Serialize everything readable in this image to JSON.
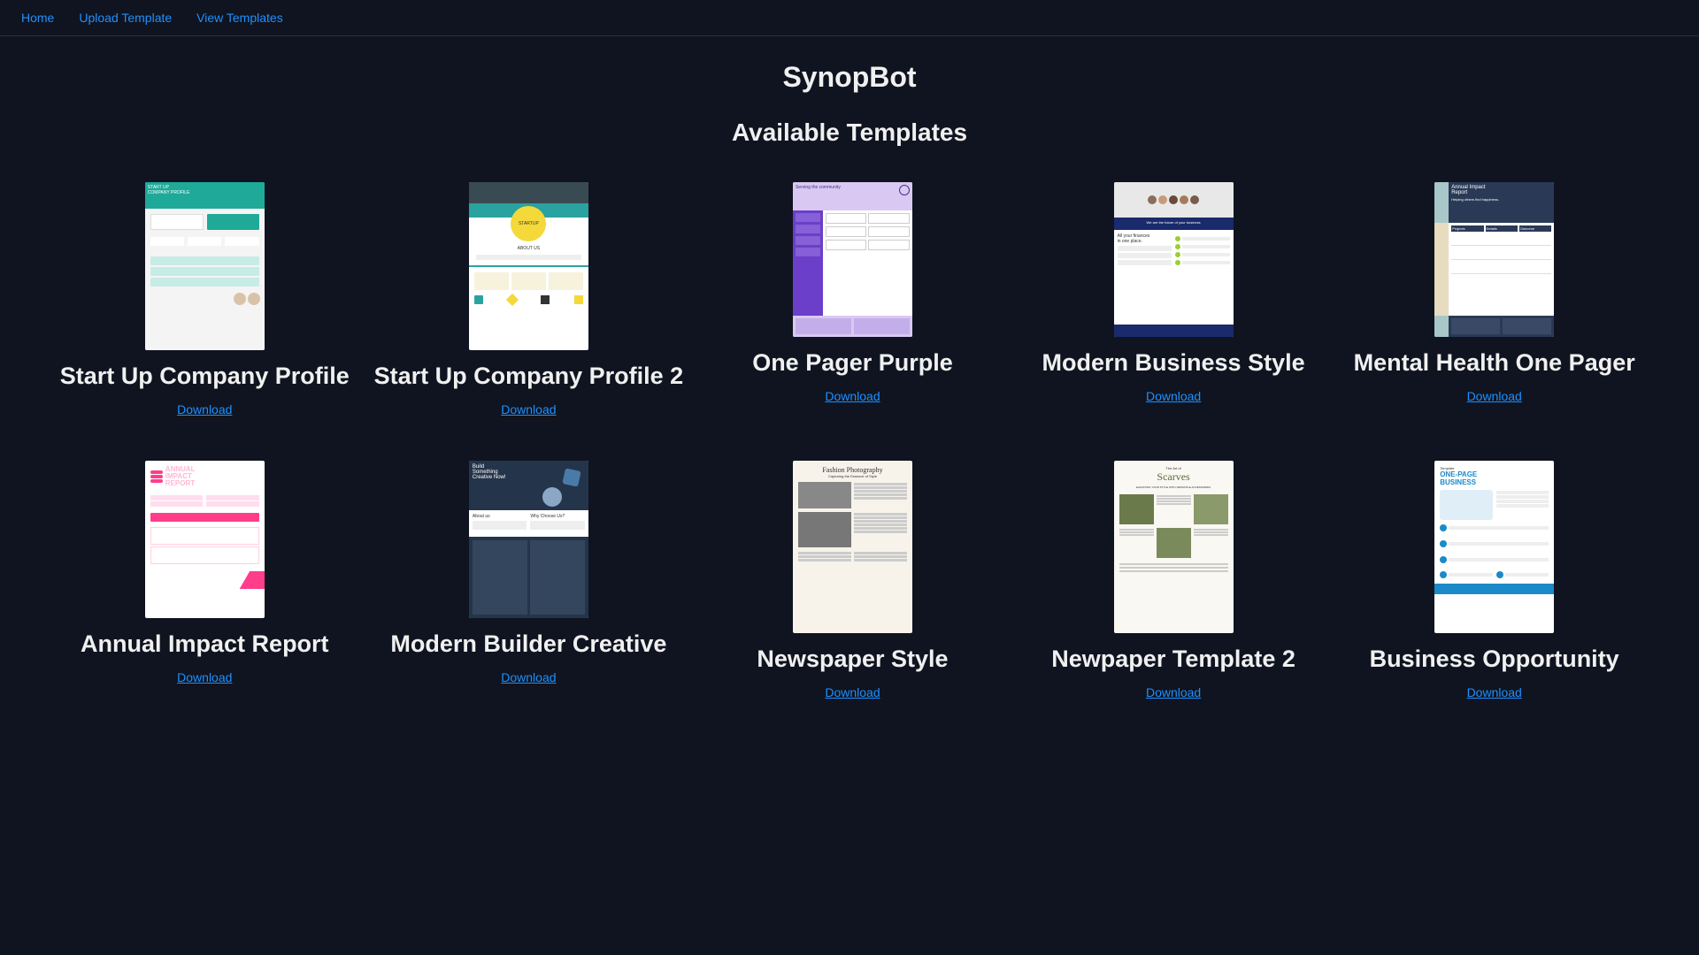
{
  "nav": {
    "home": "Home",
    "upload": "Upload Template",
    "view": "View Templates"
  },
  "header": {
    "title": "SynopBot",
    "subtitle": "Available Templates"
  },
  "download_label": "Download",
  "templates": [
    {
      "title": "Start Up Company Profile"
    },
    {
      "title": "Start Up Company Profile 2"
    },
    {
      "title": "One Pager Purple"
    },
    {
      "title": "Modern Business Style"
    },
    {
      "title": "Mental Health One Pager"
    },
    {
      "title": "Annual Impact Report"
    },
    {
      "title": "Modern Builder Creative"
    },
    {
      "title": "Newspaper Style"
    },
    {
      "title": "Newpaper Template 2"
    },
    {
      "title": "Business Opportunity"
    }
  ]
}
